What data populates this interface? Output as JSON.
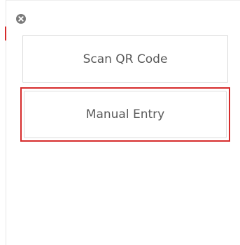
{
  "dialog": {
    "close_icon": "close-circle-icon",
    "options": {
      "scan_label": "Scan QR Code",
      "manual_label": "Manual Entry"
    }
  },
  "colors": {
    "highlight": "#d62b2b",
    "text": "#5a5a5a",
    "border": "#dcdcdc",
    "close_icon": "#7a7a7a"
  }
}
